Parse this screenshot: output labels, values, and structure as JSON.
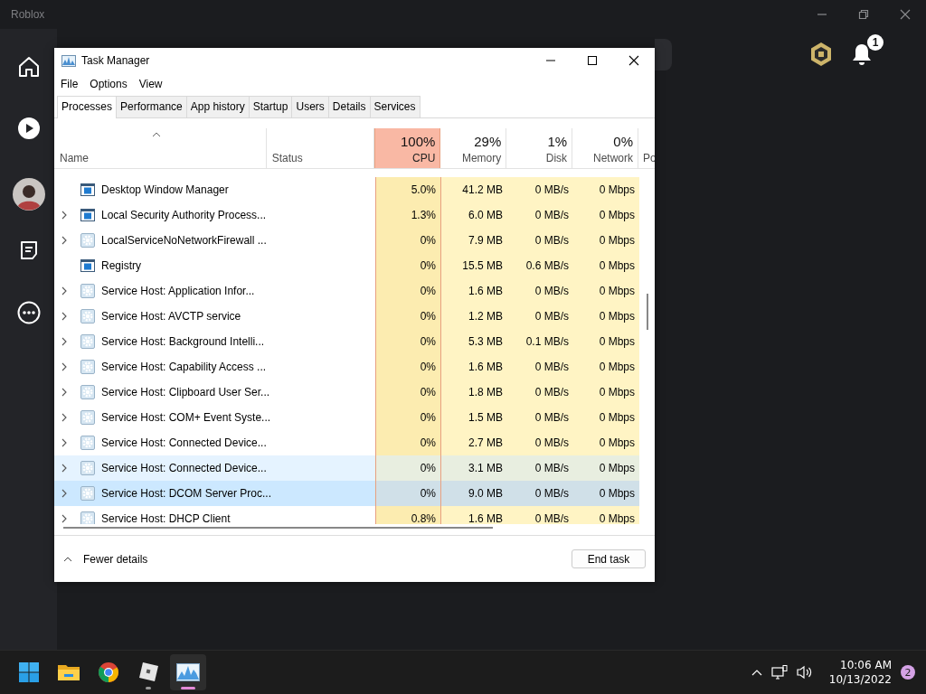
{
  "app_window": {
    "title": "Roblox"
  },
  "roblox_sidebar": [
    {
      "kind": "home",
      "selected": false
    },
    {
      "kind": "play",
      "selected": false
    },
    {
      "kind": "avatar",
      "selected": false
    },
    {
      "kind": "chat",
      "selected": false
    },
    {
      "kind": "more",
      "selected": false
    }
  ],
  "notifications": {
    "count": "1"
  },
  "task_manager": {
    "title": "Task Manager",
    "menu": [
      "File",
      "Options",
      "View"
    ],
    "tabs": [
      {
        "label": "Processes",
        "selected": true
      },
      {
        "label": "Performance",
        "selected": false
      },
      {
        "label": "App history",
        "selected": false
      },
      {
        "label": "Startup",
        "selected": false
      },
      {
        "label": "Users",
        "selected": false
      },
      {
        "label": "Details",
        "selected": false
      },
      {
        "label": "Services",
        "selected": false
      }
    ],
    "name_column": "Name",
    "status_column": "Status",
    "metric_columns": [
      {
        "label": "CPU",
        "percent": "100%",
        "alert": true
      },
      {
        "label": "Memory",
        "percent": "29%",
        "alert": false
      },
      {
        "label": "Disk",
        "percent": "1%",
        "alert": false
      },
      {
        "label": "Network",
        "percent": "0%",
        "alert": false
      }
    ],
    "cut_column": "Po",
    "rows": [
      {
        "name": "Desktop Window Manager",
        "kind": "window",
        "expandable": false,
        "hovered": false,
        "selected": false,
        "cpu": "5.0%",
        "memory": "41.2 MB",
        "disk": "0 MB/s",
        "network": "0 Mbps"
      },
      {
        "name": "Local Security Authority Process...",
        "kind": "window",
        "expandable": true,
        "hovered": false,
        "selected": false,
        "cpu": "1.3%",
        "memory": "6.0 MB",
        "disk": "0 MB/s",
        "network": "0 Mbps"
      },
      {
        "name": "LocalServiceNoNetworkFirewall ...",
        "kind": "service",
        "expandable": true,
        "hovered": false,
        "selected": false,
        "cpu": "0%",
        "memory": "7.9 MB",
        "disk": "0 MB/s",
        "network": "0 Mbps"
      },
      {
        "name": "Registry",
        "kind": "window",
        "expandable": false,
        "hovered": false,
        "selected": false,
        "cpu": "0%",
        "memory": "15.5 MB",
        "disk": "0.6 MB/s",
        "network": "0 Mbps"
      },
      {
        "name": "Service Host: Application Infor...",
        "kind": "service",
        "expandable": true,
        "hovered": false,
        "selected": false,
        "cpu": "0%",
        "memory": "1.6 MB",
        "disk": "0 MB/s",
        "network": "0 Mbps"
      },
      {
        "name": "Service Host: AVCTP service",
        "kind": "service",
        "expandable": true,
        "hovered": false,
        "selected": false,
        "cpu": "0%",
        "memory": "1.2 MB",
        "disk": "0 MB/s",
        "network": "0 Mbps"
      },
      {
        "name": "Service Host: Background Intelli...",
        "kind": "service",
        "expandable": true,
        "hovered": false,
        "selected": false,
        "cpu": "0%",
        "memory": "5.3 MB",
        "disk": "0.1 MB/s",
        "network": "0 Mbps"
      },
      {
        "name": "Service Host: Capability Access ...",
        "kind": "service",
        "expandable": true,
        "hovered": false,
        "selected": false,
        "cpu": "0%",
        "memory": "1.6 MB",
        "disk": "0 MB/s",
        "network": "0 Mbps"
      },
      {
        "name": "Service Host: Clipboard User Ser...",
        "kind": "service",
        "expandable": true,
        "hovered": false,
        "selected": false,
        "cpu": "0%",
        "memory": "1.8 MB",
        "disk": "0 MB/s",
        "network": "0 Mbps"
      },
      {
        "name": "Service Host: COM+ Event Syste...",
        "kind": "service",
        "expandable": true,
        "hovered": false,
        "selected": false,
        "cpu": "0%",
        "memory": "1.5 MB",
        "disk": "0 MB/s",
        "network": "0 Mbps"
      },
      {
        "name": "Service Host: Connected Device...",
        "kind": "service",
        "expandable": true,
        "hovered": false,
        "selected": false,
        "cpu": "0%",
        "memory": "2.7 MB",
        "disk": "0 MB/s",
        "network": "0 Mbps"
      },
      {
        "name": "Service Host: Connected Device...",
        "kind": "service",
        "expandable": true,
        "hovered": true,
        "selected": false,
        "cpu": "0%",
        "memory": "3.1 MB",
        "disk": "0 MB/s",
        "network": "0 Mbps"
      },
      {
        "name": "Service Host: DCOM Server Proc...",
        "kind": "service",
        "expandable": true,
        "hovered": false,
        "selected": true,
        "cpu": "0%",
        "memory": "9.0 MB",
        "disk": "0 MB/s",
        "network": "0 Mbps"
      },
      {
        "name": "Service Host: DHCP Client",
        "kind": "service",
        "expandable": true,
        "hovered": false,
        "selected": false,
        "cpu": "0.8%",
        "memory": "1.6 MB",
        "disk": "0 MB/s",
        "network": "0 Mbps"
      }
    ],
    "fewer_details": "Fewer details",
    "end_task": "End task"
  },
  "taskbar": {
    "apps": [
      {
        "kind": "start",
        "running": false,
        "active": false
      },
      {
        "kind": "explorer",
        "running": false,
        "active": false
      },
      {
        "kind": "chrome",
        "running": false,
        "active": false
      },
      {
        "kind": "roblox",
        "running": true,
        "active": false
      },
      {
        "kind": "taskmanager",
        "running": true,
        "active": true
      }
    ],
    "time": "10:06 AM",
    "date": "10/13/2022",
    "notification_count": "2"
  }
}
